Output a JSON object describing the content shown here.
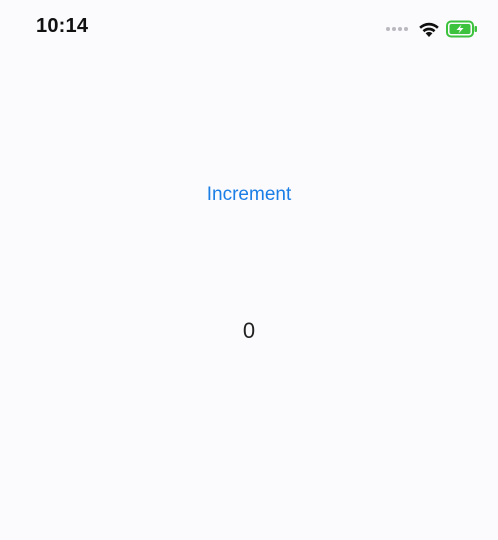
{
  "status_bar": {
    "time": "10:14",
    "icons": [
      "cellular-signal-icon",
      "wifi-icon",
      "battery-charging-icon"
    ],
    "battery_color": "#3dc23d"
  },
  "main": {
    "increment_label": "Increment",
    "counter_value": "0",
    "accent_color": "#1a7ee6"
  }
}
